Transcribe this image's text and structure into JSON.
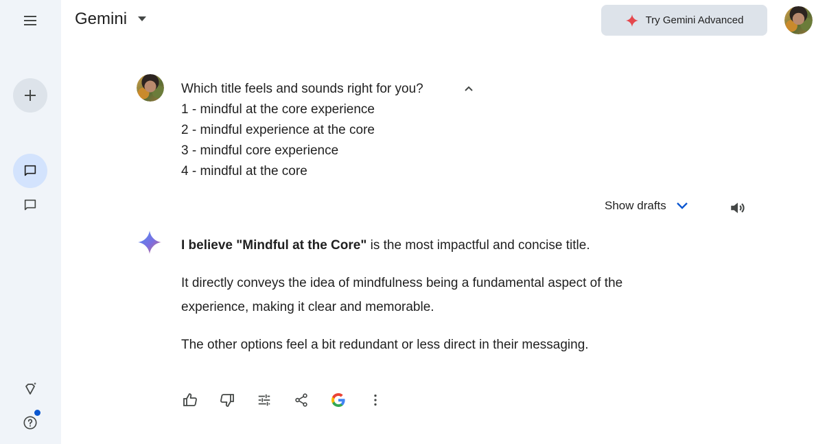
{
  "app": {
    "title": "Gemini"
  },
  "header": {
    "try_advanced_label": "Try Gemini Advanced"
  },
  "prompt": {
    "question": "Which title feels and sounds right for you?",
    "options": [
      "1 - mindful at the core experience",
      "2 - mindful experience at the core",
      "3 - mindful core experience",
      "4 - mindful at the core"
    ]
  },
  "drafts": {
    "label": "Show drafts"
  },
  "response": {
    "p1_bold": "I believe \"Mindful at the Core\"",
    "p1_rest": " is the most impactful and concise title.",
    "p2": "It directly conveys the idea of mindfulness being a fundamental aspect of the experience, making it clear and memorable.",
    "p3": "The other options feel a bit redundant or less direct in their messaging."
  },
  "icons": {
    "menu": "menu-icon",
    "new_chat": "plus-icon",
    "chat": "chat-bubble-icon",
    "gem": "gem-icon",
    "help": "help-icon",
    "dropdown": "caret-down-icon",
    "sparkle": "sparkle-icon",
    "collapse": "chevron-up-icon",
    "drafts_toggle": "chevron-down-icon",
    "speaker": "speaker-icon",
    "thumb_up": "thumb-up-icon",
    "thumb_down": "thumb-down-icon",
    "modify": "tune-icon",
    "share": "share-icon",
    "google": "google-icon",
    "more": "more-vert-icon"
  },
  "colors": {
    "sidebar_bg": "#f0f4f9",
    "active_chat_bg": "#d3e3fd",
    "accent_blue": "#0b57d0",
    "try_button_bg": "#dde3ea",
    "sparkle_red": "#e5484d"
  }
}
